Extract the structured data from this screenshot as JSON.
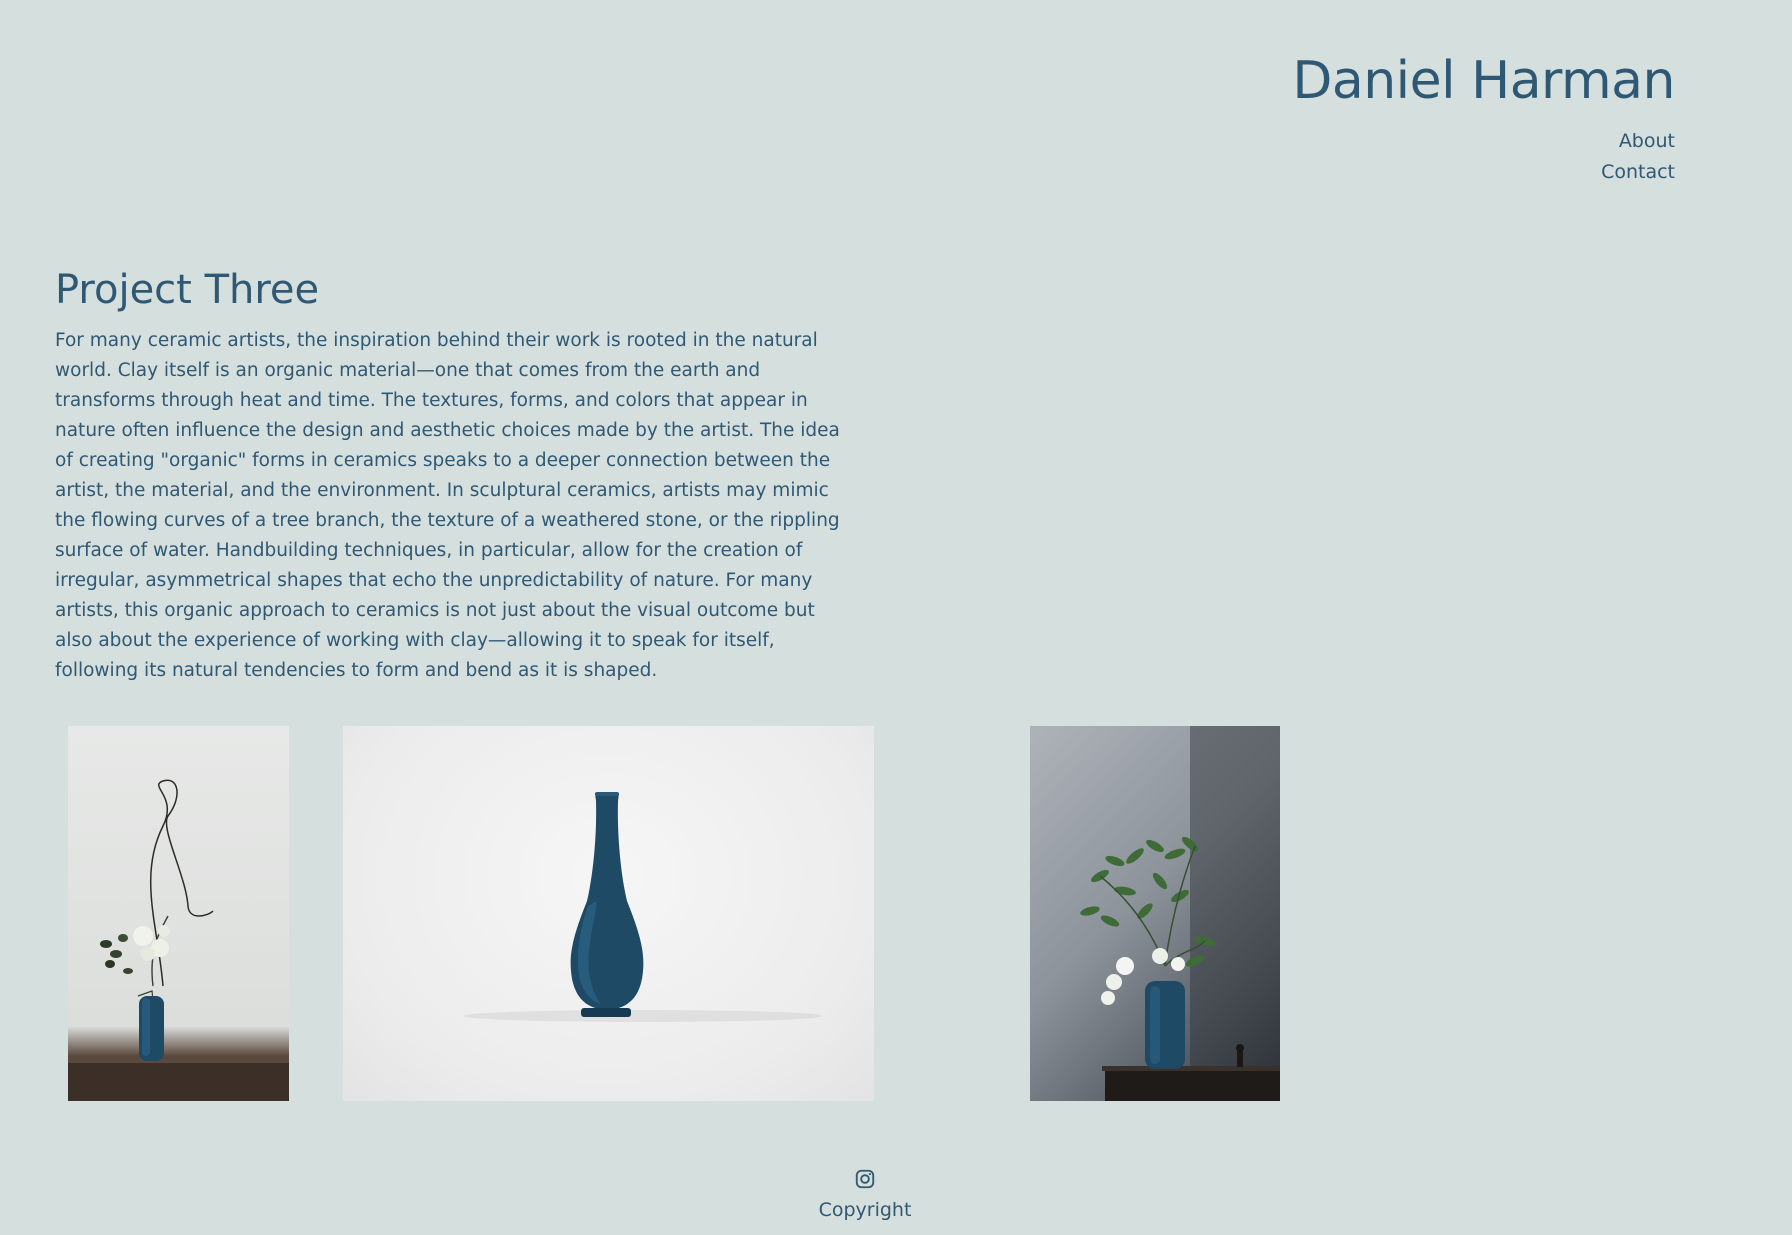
{
  "site": {
    "title": "Daniel Harman"
  },
  "nav": {
    "items": [
      {
        "label": "About"
      },
      {
        "label": "Contact"
      }
    ]
  },
  "project": {
    "title": "Project Three",
    "description": "For many ceramic artists, the inspiration behind their work is rooted in the natural world. Clay itself is an organic material—one that comes from the earth and transforms through heat and time. The textures, forms, and colors that appear in nature often influence the design and aesthetic choices made by the artist. The idea of creating \"organic\" forms in ceramics speaks to a deeper connection between the artist, the material, and the environment. In sculptural ceramics, artists may mimic the flowing curves of a tree branch, the texture of a weathered stone, or the rippling surface of water. Handbuilding techniques, in particular, allow for the creation of irregular, asymmetrical shapes that echo the unpredictability of nature. For many artists, this organic approach to ceramics is not just about the visual outcome but also about the experience of working with clay—allowing it to speak for itself, following its natural tendencies to form and bend as it is shaped."
  },
  "footer": {
    "icon": "instagram-icon",
    "copyright": "Copyright"
  },
  "colors": {
    "background": "#d5dfdd",
    "text": "#2f5875",
    "vase_blue": "#1f4a66"
  }
}
